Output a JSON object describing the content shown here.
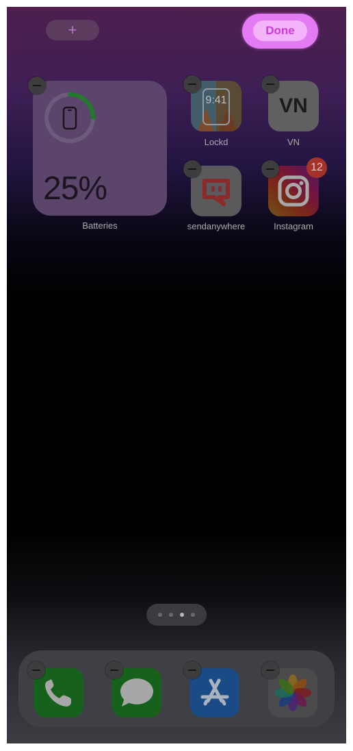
{
  "header": {
    "add_label": "+",
    "done_label": "Done"
  },
  "widget": {
    "percent_text": "25%",
    "level": 0.25,
    "label": "Batteries"
  },
  "apps": [
    {
      "name": "lockd",
      "label": "Lockd",
      "icon_text": "9:41"
    },
    {
      "name": "vn",
      "label": "VN",
      "icon_text": "VN"
    },
    {
      "name": "sendanywhere",
      "label": "sendanywhere"
    },
    {
      "name": "instagram",
      "label": "Instagram",
      "badge": "12"
    }
  ],
  "page_dots": {
    "count": 4,
    "active": 2
  },
  "dock": [
    "phone-icon",
    "messages-icon",
    "app-store-icon",
    "photos-icon"
  ],
  "colors": {
    "done_accent": "#e57af5",
    "battery_ring": "#1f7a2b",
    "badge": "#a3322b"
  }
}
